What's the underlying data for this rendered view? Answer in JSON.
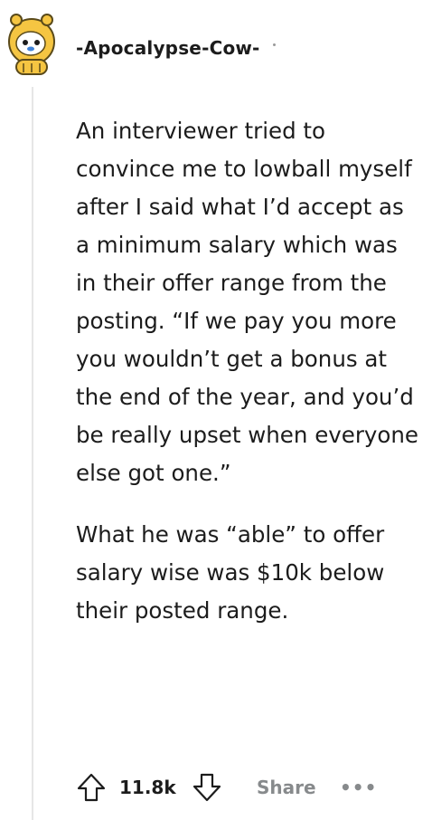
{
  "comment": {
    "author": "-Apocalypse-Cow-",
    "paragraphs": [
      "An interviewer tried to convince me to lowball myself after I said what I’d accept as a minimum salary which was in their offer range from the posting. “If we pay you more you wouldn’t get a bonus at the end of the year, and you’d be really upset when everyone else got one.”",
      "What he was “able” to offer salary wise was $10k below their posted range."
    ],
    "score": "11.8k",
    "share_label": "Share",
    "more_label": "•••"
  },
  "icons": {
    "avatar": "snoo-avatar-icon",
    "upvote": "upvote-arrow-icon",
    "downvote": "downvote-arrow-icon",
    "more": "more-options-icon"
  },
  "colors": {
    "text": "#1c1c1c",
    "muted": "#878a8c",
    "thread_line": "#e6e6e6",
    "avatar_yellow": "#f5c542",
    "avatar_blue": "#3f82d8"
  }
}
